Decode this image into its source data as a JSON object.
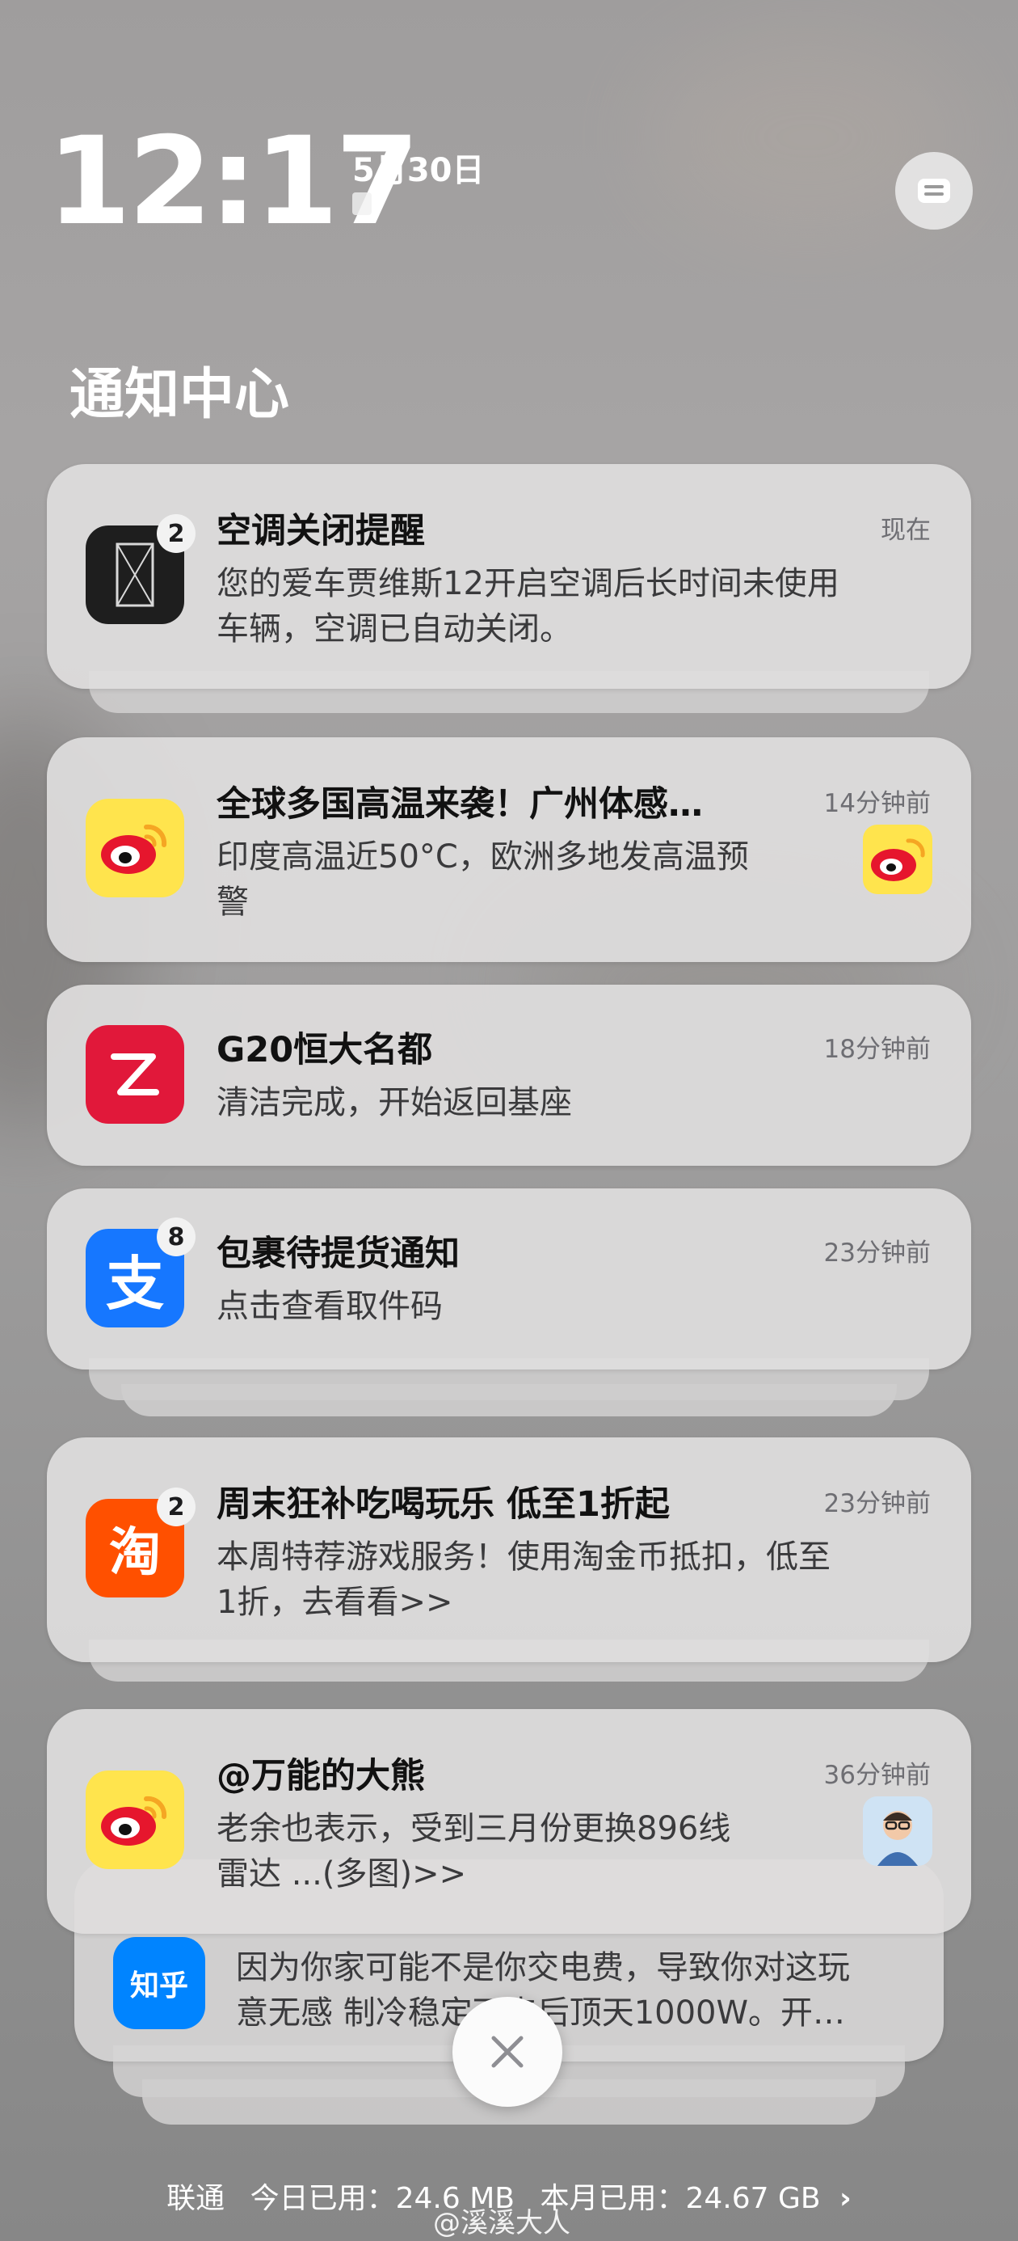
{
  "status": {
    "time": "12:17",
    "date": "5月30日"
  },
  "center_title": "通知中心",
  "notifications": [
    {
      "app_icon": "jiawei-app-icon",
      "badge": "2",
      "title": "空调关闭提醒",
      "time": "现在",
      "body_line1": "您的爱车贾维斯12开启空调后长时间未使用",
      "body_line2": "车辆，空调已自动关闭。"
    },
    {
      "app_icon": "weibo-icon",
      "title": "全球多国高温来袭！广州体感…",
      "time": "14分钟前",
      "body_line1": "印度高温近50°C，欧洲多地发高温预",
      "body_line2": "警"
    },
    {
      "app_icon": "roborock-icon",
      "title": "G20恒大名都",
      "time": "18分钟前",
      "body_line1": "清洁完成，开始返回基座"
    },
    {
      "app_icon": "alipay-icon",
      "badge": "8",
      "title": "包裹待提货通知",
      "time": "23分钟前",
      "body_line1": "点击查看取件码"
    },
    {
      "app_icon": "taobao-icon",
      "badge": "2",
      "title": "周末狂补吃喝玩乐 低至1折起",
      "time": "23分钟前",
      "body_line1": "本周特荐游戏服务！使用淘金币抵扣，低至",
      "body_line2": "1折，去看看>>",
      "icon_glyph": "淘"
    },
    {
      "app_icon": "weibo-icon",
      "title": "@万能的大熊",
      "time": "36分钟前",
      "body_line1": "老余也表示，受到三月份更换896线",
      "body_line2": "雷达 ...(多图)>>"
    }
  ],
  "peek": {
    "app_icon": "zhihu-icon",
    "icon_text": "知乎",
    "body_line1": "因为你家可能不是你交电费，导致你对这玩",
    "body_line2": "意无感 制冷稳定下来后顶天1000W。开…"
  },
  "alipay_glyph": "支",
  "footer": {
    "carrier": "联通",
    "today_label": "今日已用：",
    "today_value": "24.6 MB",
    "month_label": "本月已用：",
    "month_value": "24.67 GB"
  },
  "watermark": "@溪溪大人",
  "colors": {
    "weibo_bg": "#ffe44d",
    "weibo_red": "#e6162d",
    "roborock_red": "#e1183a",
    "alipay_blue": "#1677ff",
    "taobao_orange": "#ff5000",
    "zhihu_blue": "#0084ff"
  }
}
